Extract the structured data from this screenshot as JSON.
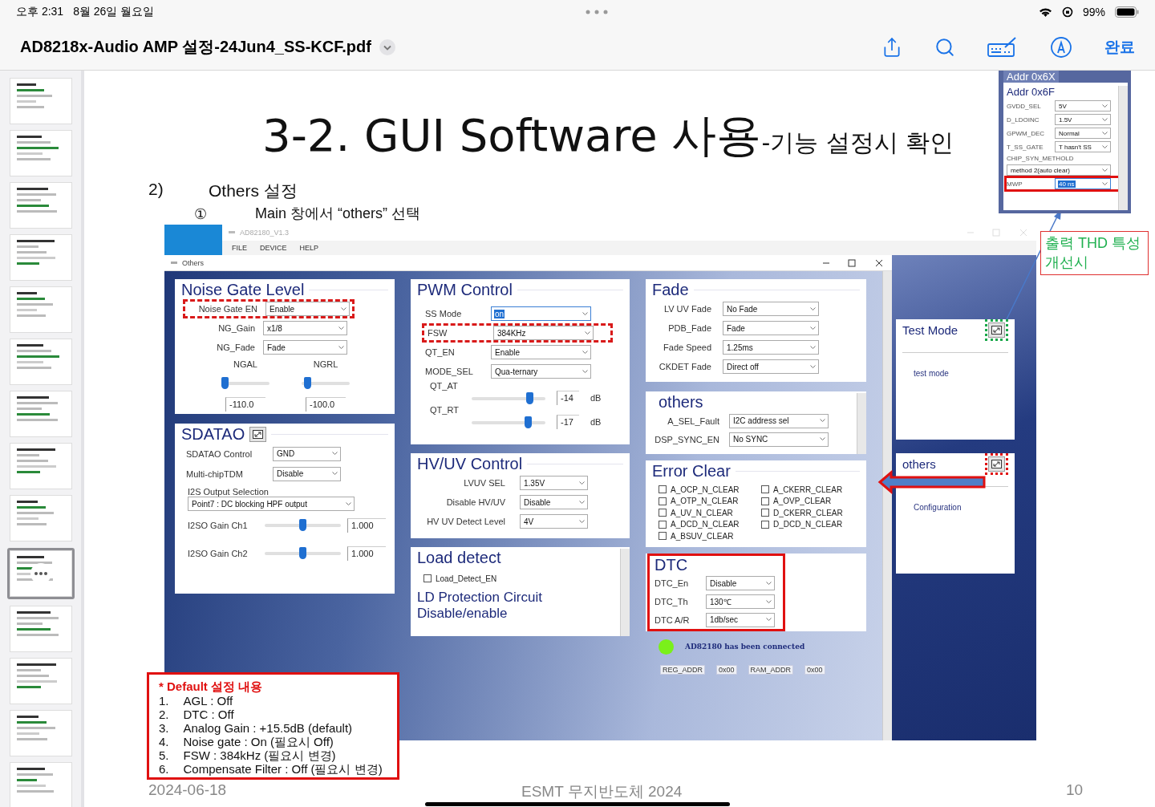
{
  "status_bar": {
    "time": "오후 2:31",
    "date": "8월 26일 월요일",
    "battery": "99%"
  },
  "toolbar": {
    "title": "AD8218x-Audio AMP 설정-24Jun4_SS-KCF.pdf",
    "done": "완료"
  },
  "thumbnails": [
    {
      "selected": false
    },
    {
      "selected": false
    },
    {
      "selected": false
    },
    {
      "selected": false
    },
    {
      "selected": false
    },
    {
      "selected": false
    },
    {
      "selected": false
    },
    {
      "selected": false
    },
    {
      "selected": false
    },
    {
      "selected": true
    },
    {
      "selected": false
    },
    {
      "selected": false
    },
    {
      "selected": false
    },
    {
      "selected": false
    }
  ],
  "slide": {
    "title": "3-2. GUI Software 사용",
    "title_suffix": "-기능 설정시 확인",
    "section_number": "2)",
    "section": "Others 설정",
    "step_marker": "①",
    "step": "Main 창에서 “others” 선택",
    "date": "2024-06-18",
    "footer": "ESMT 무지반도체 2024",
    "page": "10"
  },
  "app": {
    "title": "AD82180_V1.3",
    "menu": [
      "FILE",
      "DEVICE",
      "HELP"
    ],
    "subwindow": "Others",
    "noise_gate": {
      "title": "Noise Gate Level",
      "rows": [
        {
          "label": "Noise Gate EN",
          "value": "Enable",
          "highlighted": true
        },
        {
          "label": "NG_Gain",
          "value": "x1/8",
          "highlighted": false
        },
        {
          "label": "NG_Fade",
          "value": "Fade",
          "highlighted": false
        }
      ],
      "sliders": [
        {
          "label": "NGAL",
          "level": 0.0,
          "reading": "-110.0"
        },
        {
          "label": "NGRL",
          "level": 0.05,
          "reading": "-100.0"
        }
      ]
    },
    "sdatao": {
      "title": "SDATAO",
      "rows": [
        {
          "label": "SDATAO Control",
          "value": "GND"
        },
        {
          "label": "Multi-chipTDM",
          "value": "Disable"
        }
      ],
      "output": {
        "label": "I2S Output Selection",
        "value": "Point7 : DC blocking HPF output"
      },
      "gains": [
        {
          "label": "I2SO Gain Ch1",
          "level": 0.5,
          "reading": "1.000"
        },
        {
          "label": "I2SO Gain Ch2",
          "level": 0.5,
          "reading": "1.000"
        }
      ]
    },
    "pwm": {
      "title": "PWM Control",
      "rows": [
        {
          "label": "SS Mode",
          "value": "on",
          "highlighted": false,
          "focused": true
        },
        {
          "label": "FSW",
          "value": "384KHz",
          "highlighted": true,
          "focused": false
        },
        {
          "label": "QT_EN",
          "value": "Enable",
          "highlighted": false,
          "focused": false
        },
        {
          "label": "MODE_SEL",
          "value": "Qua-ternary",
          "highlighted": false,
          "focused": false
        }
      ],
      "sliders": [
        {
          "label": "QT_AT",
          "level": 0.82,
          "reading": "-14",
          "unit": "dB"
        },
        {
          "label": "QT_RT",
          "level": 0.8,
          "reading": "-17",
          "unit": "dB"
        }
      ]
    },
    "hvuv": {
      "title": "HV/UV Control",
      "rows": [
        {
          "label": "LVUV SEL",
          "value": "1.35V"
        },
        {
          "label": "Disable HV/UV",
          "value": "Disable"
        },
        {
          "label": "HV UV Detect Level",
          "value": "4V"
        }
      ]
    },
    "load_detect": {
      "title": "Load detect",
      "checkbox": {
        "label": "Load_Detect_EN",
        "checked": false
      },
      "note": [
        "LD Protection Circuit",
        "Disable/enable"
      ]
    },
    "fade": {
      "title": "Fade",
      "rows": [
        {
          "label": "LV UV Fade",
          "value": "No Fade"
        },
        {
          "label": "PDB_Fade",
          "value": "Fade"
        },
        {
          "label": "Fade Speed",
          "value": "1.25ms"
        },
        {
          "label": "CKDET Fade",
          "value": "Direct off"
        }
      ]
    },
    "others": {
      "title": "others",
      "rows": [
        {
          "label": "A_SEL_Fault",
          "value": "I2C address sel"
        },
        {
          "label": "DSP_SYNC_EN",
          "value": "No SYNC"
        }
      ]
    },
    "error_clear": {
      "title": "Error Clear",
      "columns": [
        [
          {
            "label": "A_OCP_N_CLEAR",
            "checked": false
          },
          {
            "label": "A_OTP_N_CLEAR",
            "checked": false
          },
          {
            "label": "A_UV_N_CLEAR",
            "checked": false
          },
          {
            "label": "A_DCD_N_CLEAR",
            "checked": false
          },
          {
            "label": "A_BSUV_CLEAR",
            "checked": false
          }
        ],
        [
          {
            "label": "A_CKERR_CLEAR",
            "checked": false
          },
          {
            "label": "A_OVP_CLEAR",
            "checked": false
          },
          {
            "label": "D_CKERR_CLEAR",
            "checked": false
          },
          {
            "label": "D_DCD_N_CLEAR",
            "checked": false
          }
        ]
      ]
    },
    "dtc": {
      "title": "DTC",
      "highlighted": true,
      "rows": [
        {
          "label": "DTC_En",
          "value": "Disable"
        },
        {
          "label": "DTC_Th",
          "value": "130℃"
        },
        {
          "label": "DTC A/R",
          "value": "1db/sec"
        }
      ]
    },
    "connection": {
      "connected": true,
      "text": "AD82180 has been connected"
    },
    "registers": [
      {
        "label": "REG_ADDR",
        "value": "0x00"
      },
      {
        "label": "RAM_ADDR",
        "value": "0x00"
      }
    ],
    "side_panels": [
      {
        "title": "Test Mode",
        "body": "test mode",
        "color": "#1aa84a"
      },
      {
        "title": "others",
        "body": "Configuration",
        "color": "#e01010"
      }
    ]
  },
  "addr_popup": {
    "tab": "Addr 0x6X",
    "title": "Addr 0x6F",
    "rows": [
      {
        "kind": "inline",
        "label": "GVDD_SEL",
        "value": "5V",
        "highlighted": false
      },
      {
        "kind": "inline",
        "label": "D_LDOINC",
        "value": "1.5V",
        "highlighted": false
      },
      {
        "kind": "inline",
        "label": "GPWM_DEC",
        "value": "Normal",
        "highlighted": false
      },
      {
        "kind": "inline",
        "label": "T_SS_GATE",
        "value": "T hasn't SS",
        "highlighted": false
      },
      {
        "kind": "wide",
        "label": "CHIP_SYN_METHOLD",
        "value": "method 2(auto clear)",
        "highlighted": false
      },
      {
        "kind": "inline",
        "label": "MWP",
        "value": "40 ns",
        "highlighted": true
      }
    ]
  },
  "callout": {
    "lines": [
      "출력 THD 특성",
      "개선시"
    ]
  },
  "defaults": {
    "title": "* Default 설정 내용",
    "items": [
      {
        "num": "1.",
        "text": "AGL : Off"
      },
      {
        "num": "2.",
        "text": "DTC : Off"
      },
      {
        "num": "3.",
        "text": "Analog Gain : +15.5dB (default)"
      },
      {
        "num": "4.",
        "text": "Noise gate : On (필요시 Off)"
      },
      {
        "num": "5.",
        "text": "FSW : 384kHz (필요시 변경)"
      },
      {
        "num": "6.",
        "text": "Compensate Filter : Off (필요시 변경)"
      }
    ]
  }
}
